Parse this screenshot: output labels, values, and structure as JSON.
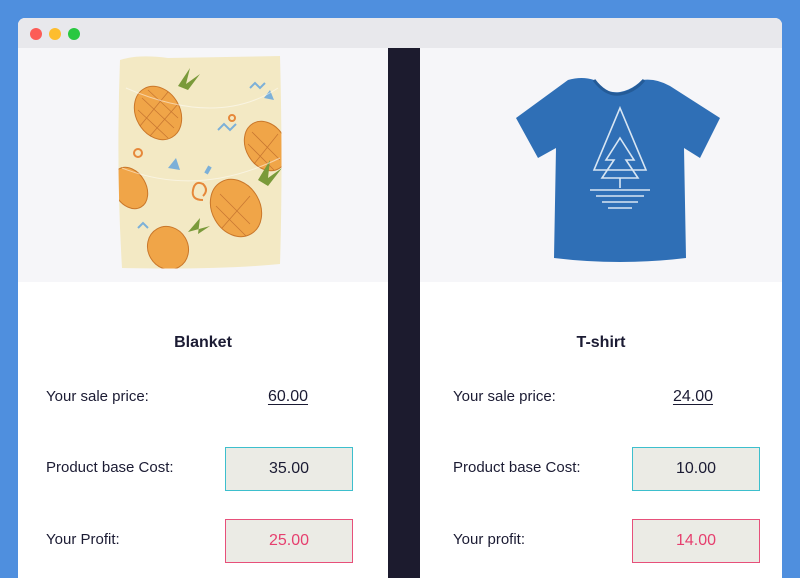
{
  "colors": {
    "background": "#4f8fde",
    "divider": "#1c1b2e",
    "cost_border": "#3dbfcd",
    "profit_border": "#e7507a",
    "profit_text": "#e63f6e"
  },
  "products": [
    {
      "title": "Blanket",
      "image_icon": "pineapple-blanket-image",
      "sale_price_label": "Your sale price:",
      "sale_price": "60.00",
      "base_cost_label": "Product base Cost:",
      "base_cost": "35.00",
      "profit_label": "Your Profit:",
      "profit": "25.00"
    },
    {
      "title": "T-shirt",
      "image_icon": "tshirt-image",
      "sale_price_label": "Your sale price:",
      "sale_price": "24.00",
      "base_cost_label": "Product base Cost:",
      "base_cost": "10.00",
      "profit_label": "Your profit:",
      "profit": "14.00"
    }
  ]
}
